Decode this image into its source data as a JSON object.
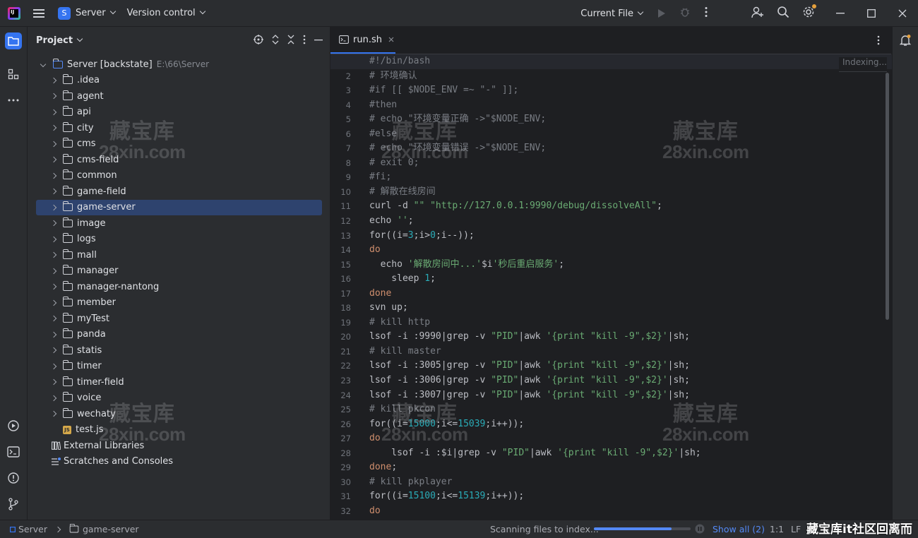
{
  "titlebar": {
    "project_letter": "S",
    "project_name": "Server",
    "vcs": "Version control",
    "run_config": "Current File"
  },
  "project_panel": {
    "title": "Project",
    "root_name": "Server [backstate]",
    "root_path": "E:\\66\\Server",
    "folders": [
      ".idea",
      "agent",
      "api",
      "city",
      "cms",
      "cms-field",
      "common",
      "game-field",
      "game-server",
      "image",
      "logs",
      "mall",
      "manager",
      "manager-nantong",
      "member",
      "myTest",
      "panda",
      "statis",
      "timer",
      "timer-field",
      "voice",
      "wechaty"
    ],
    "selected_folder": "game-server",
    "file": "test.js",
    "external_libraries": "External Libraries",
    "scratches": "Scratches and Consoles"
  },
  "editor": {
    "tab_name": "run.sh",
    "indexing_label": "Indexing...",
    "current_line": 1,
    "lines": [
      "#!/bin/bash",
      "# 环境确认",
      "#if [[ $NODE_ENV =~ \"-\" ]];",
      "#then",
      "# echo \"环境变量正确 ->\"$NODE_ENV;",
      "#else",
      "# echo \"环境变量错误 ->\"$NODE_ENV;",
      "# exit 0;",
      "#fi;",
      "# 解散在线房间",
      "curl -d \"\" \"http://127.0.0.1:9990/debug/dissolveAll\";",
      "echo '';",
      "for((i=3;i>0;i--));",
      "do",
      "  echo '解散房间中...'$i'秒后重启服务';",
      "    sleep 1;",
      "done",
      "svn up;",
      "# kill http",
      "lsof -i :9990|grep -v \"PID\"|awk '{print \"kill -9\",$2}'|sh;",
      "# kill master",
      "lsof -i :3005|grep -v \"PID\"|awk '{print \"kill -9\",$2}'|sh;",
      "lsof -i :3006|grep -v \"PID\"|awk '{print \"kill -9\",$2}'|sh;",
      "lsof -i :3007|grep -v \"PID\"|awk '{print \"kill -9\",$2}'|sh;",
      "# kill pkcon",
      "for((i=15000;i<=15039;i++));",
      "do",
      "    lsof -i :$i|grep -v \"PID\"|awk '{print \"kill -9\",$2}'|sh;",
      "done;",
      "# kill pkplayer",
      "for((i=15100;i<=15139;i++));",
      "do"
    ]
  },
  "statusbar": {
    "breadcrumb_root": "Server",
    "breadcrumb_folder": "game-server",
    "scanning_text": "Scanning files to index...",
    "progress": 0.8,
    "show_all": "Show all (2)",
    "position": "1:1",
    "line_sep": "LF"
  },
  "watermark": {
    "line1": "藏宝库",
    "line2": "28xin.com",
    "footer": "藏宝库it社区回离而"
  },
  "colors": {
    "accent": "#3574f0",
    "selection": "#2e436e",
    "comment": "#7a7e85",
    "keyword": "#cf8e6d",
    "string": "#6aab73",
    "number": "#2aacb8"
  }
}
